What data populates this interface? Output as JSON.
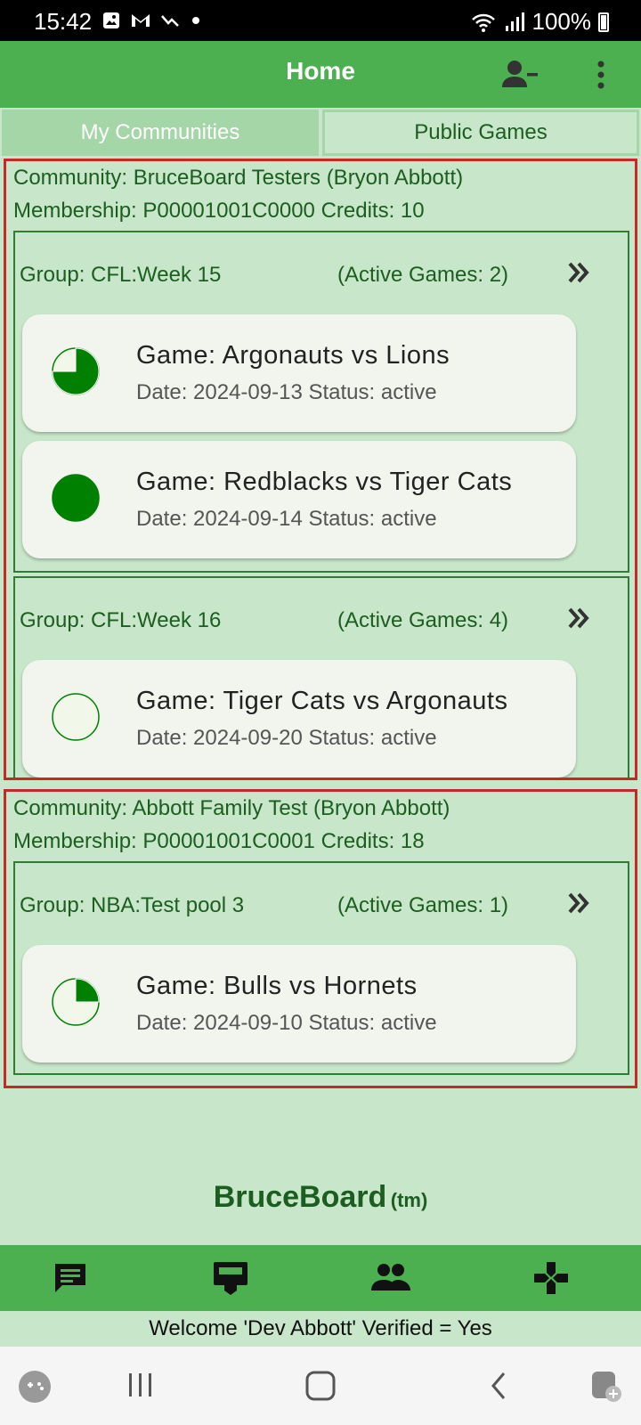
{
  "status_bar": {
    "time": "15:42",
    "battery": "100%"
  },
  "app_bar": {
    "title": "Home"
  },
  "tabs": [
    {
      "label": "My Communities",
      "active": true
    },
    {
      "label": "Public Games",
      "active": false
    }
  ],
  "communities": [
    {
      "title": "Community: BruceBoard Testers (Bryon Abbott)",
      "membership": "Membership: P00001001C0000  Credits: 10",
      "groups": [
        {
          "name": "Group: CFL:Week 15",
          "active_games": "(Active Games: 2)",
          "games": [
            {
              "title": "Game: Argonauts vs Lions",
              "meta": "Date: 2024-09-13 Status: active",
              "progress": 0.75
            },
            {
              "title": "Game: Redblacks vs Tiger Cats",
              "meta": "Date: 2024-09-14 Status: active",
              "progress": 1.0
            }
          ]
        },
        {
          "name": "Group: CFL:Week 16",
          "active_games": "(Active Games: 4)",
          "games": [
            {
              "title": "Game: Tiger Cats vs Argonauts",
              "meta": "Date: 2024-09-20 Status: active",
              "progress": 0.0
            }
          ]
        }
      ]
    },
    {
      "title": "Community: Abbott Family Test (Bryon Abbott)",
      "membership": "Membership: P00001001C0001  Credits: 18",
      "groups": [
        {
          "name": "Group: NBA:Test pool 3",
          "active_games": "(Active Games: 1)",
          "games": [
            {
              "title": "Game: Bulls vs Hornets",
              "meta": "Date: 2024-09-10 Status: active",
              "progress": 0.25
            }
          ]
        }
      ]
    }
  ],
  "brand": {
    "name": "BruceBoard",
    "tm": "(tm)"
  },
  "bottom_nav": [
    "chat-icon",
    "board-icon",
    "people-icon",
    "gamepad-icon"
  ],
  "welcome": "Welcome 'Dev Abbott' Verified = Yes",
  "colors": {
    "primary": "#4caf50",
    "background": "#c8e6c9",
    "text": "#1b5e20",
    "community_border": "#c62828",
    "pie_fill": "#008000"
  }
}
